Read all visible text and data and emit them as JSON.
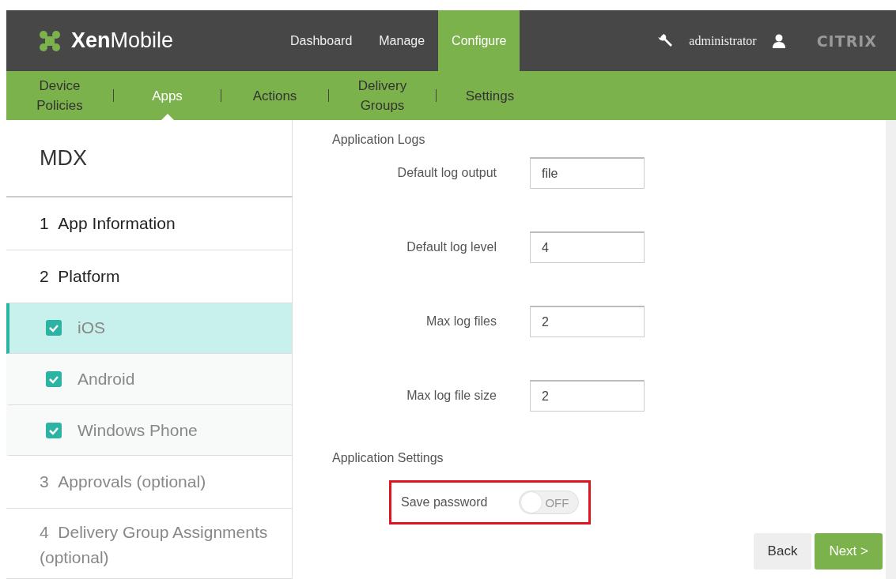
{
  "header": {
    "brand_bold": "Xen",
    "brand_light": "Mobile",
    "nav": [
      {
        "label": "Dashboard",
        "selected": false
      },
      {
        "label": "Manage",
        "selected": false
      },
      {
        "label": "Configure",
        "selected": true
      }
    ],
    "user": "administrator",
    "vendor": "CITRIX"
  },
  "subnav": [
    {
      "label": "Device\nPolicies",
      "selected": false
    },
    {
      "label": "Apps",
      "selected": true
    },
    {
      "label": "Actions",
      "selected": false
    },
    {
      "label": "Delivery\nGroups",
      "selected": false
    },
    {
      "label": "Settings",
      "selected": false
    }
  ],
  "sidebar": {
    "title": "MDX",
    "items": [
      {
        "number": "1",
        "label": "App Information",
        "disabled": false
      },
      {
        "number": "2",
        "label": "Platform",
        "disabled": false,
        "children": [
          {
            "label": "iOS",
            "checked": true,
            "selected": true
          },
          {
            "label": "Android",
            "checked": true,
            "selected": false
          },
          {
            "label": "Windows Phone",
            "checked": true,
            "selected": false
          }
        ]
      },
      {
        "number": "3",
        "label": "Approvals (optional)",
        "disabled": true
      },
      {
        "number": "4",
        "label": "Delivery Group Assignments (optional)",
        "disabled": true
      }
    ]
  },
  "sections": [
    {
      "title": "Application Logs",
      "fields": [
        {
          "kind": "text",
          "label": "Default log output",
          "value": "file"
        },
        {
          "kind": "text",
          "label": "Default log level",
          "value": "4"
        },
        {
          "kind": "text",
          "label": "Max log files",
          "value": "2"
        },
        {
          "kind": "text",
          "label": "Max log file size",
          "value": "2"
        }
      ]
    },
    {
      "title": "Application Settings",
      "fields": [
        {
          "kind": "toggle",
          "label": "Save password",
          "on": false,
          "state_text": "OFF",
          "highlighted": true
        }
      ]
    }
  ],
  "buttons": [
    {
      "label": "Back",
      "kind": "secondary"
    },
    {
      "label": "Next >",
      "kind": "primary"
    }
  ]
}
